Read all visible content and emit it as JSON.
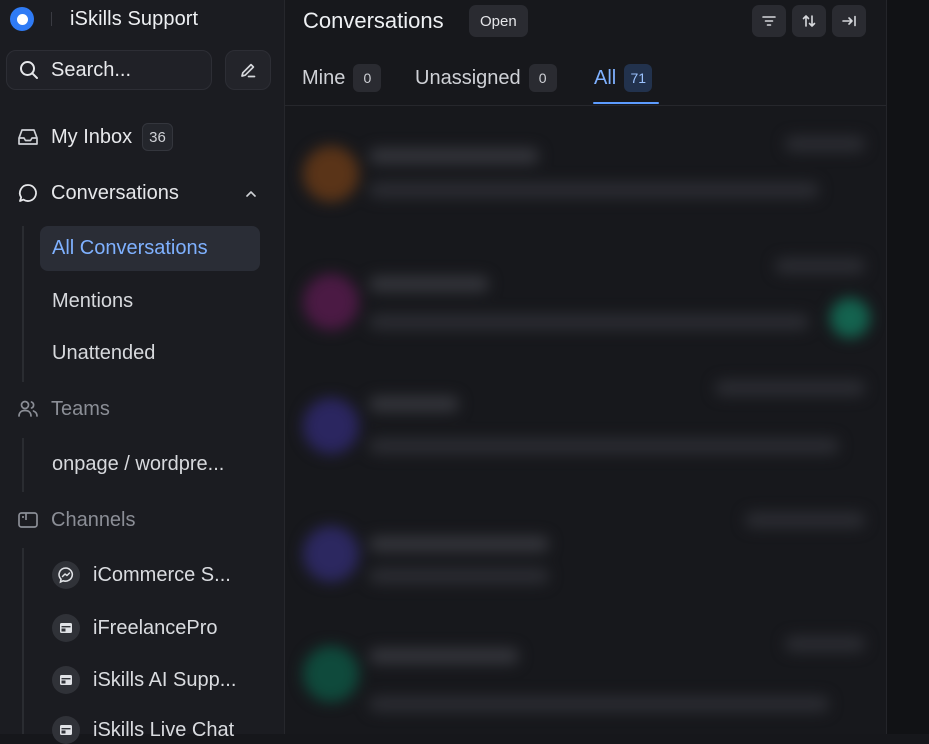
{
  "sidebar": {
    "brand_title": "iSkills Support",
    "search_placeholder": "Search...",
    "my_inbox": {
      "label": "My Inbox",
      "count": "36"
    },
    "conversations": {
      "label": "Conversations",
      "items": [
        {
          "label": "All Conversations",
          "active": true
        },
        {
          "label": "Mentions"
        },
        {
          "label": "Unattended"
        }
      ]
    },
    "teams": {
      "label": "Teams",
      "items": [
        {
          "label": "onpage / wordpre..."
        }
      ]
    },
    "channels": {
      "label": "Channels",
      "items": [
        {
          "label": "iCommerce S...",
          "icon": "messenger-icon"
        },
        {
          "label": "iFreelancePro",
          "icon": "website-icon"
        },
        {
          "label": "iSkills AI Supp...",
          "icon": "website-icon"
        },
        {
          "label": "iSkills Live Chat",
          "icon": "website-icon"
        }
      ]
    }
  },
  "main": {
    "title": "Conversations",
    "status": "Open",
    "tabs": [
      {
        "label": "Mine",
        "count": "0"
      },
      {
        "label": "Unassigned",
        "count": "0"
      },
      {
        "label": "All",
        "count": "71",
        "active": true
      }
    ]
  },
  "colors": {
    "accent": "#5d9cff",
    "brand": "#2f7bf5",
    "background": "#16171b"
  }
}
